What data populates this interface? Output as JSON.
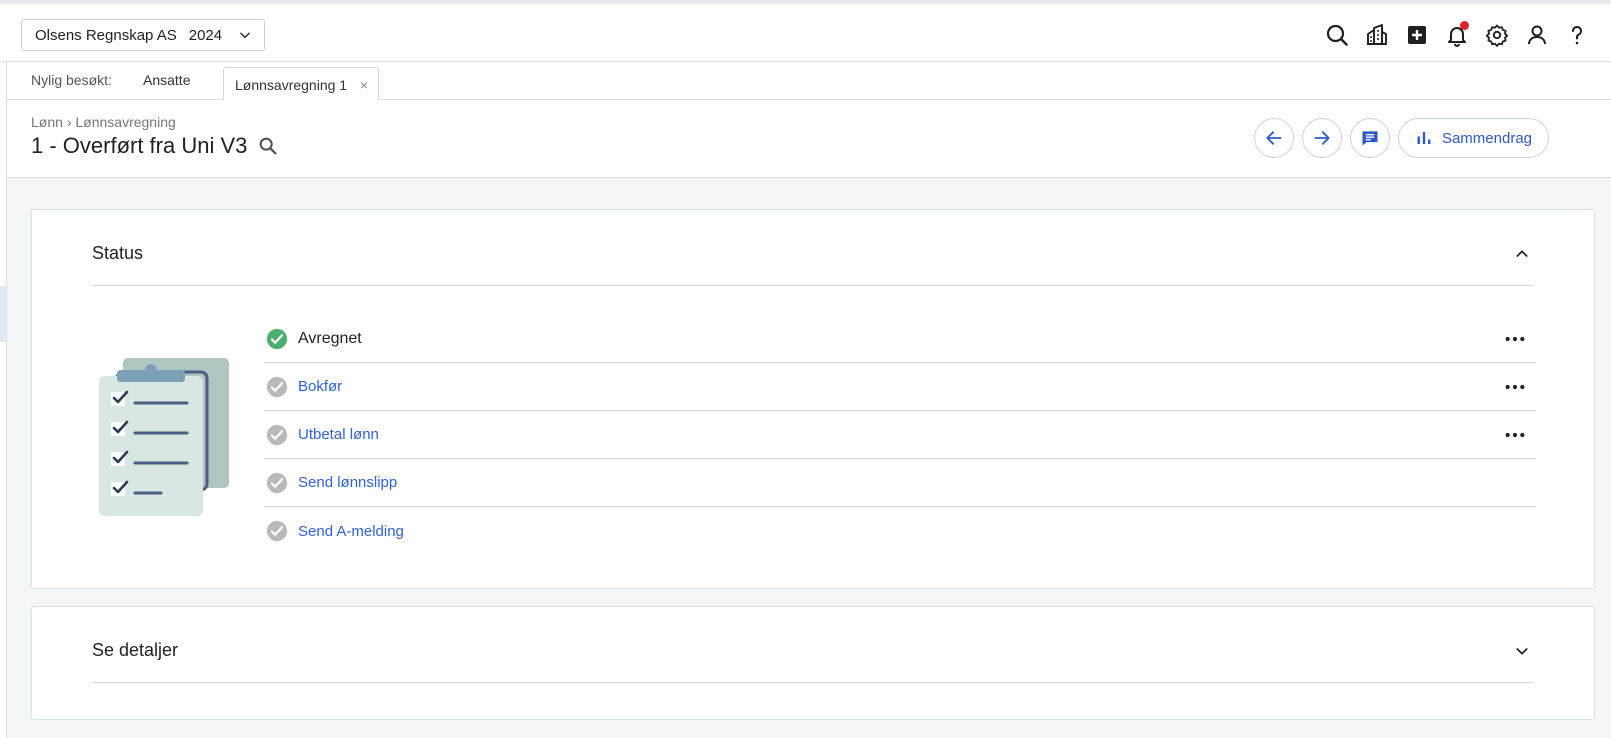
{
  "topbar": {
    "company": "Olsens Regnskap AS",
    "year": "2024",
    "icons": [
      "search-icon",
      "companies-icon",
      "new-icon",
      "notifications-icon",
      "settings-icon",
      "user-icon",
      "help-icon"
    ]
  },
  "tabs": {
    "recent_label": "Nylig besøkt:",
    "items": [
      "Ansatte",
      "Lønnsavregning 1"
    ],
    "close": "×"
  },
  "header": {
    "breadcrumb": [
      "Lønn",
      "Lønnsavregning"
    ],
    "breadcrumb_sep": "›",
    "title": "1 - Overført fra Uni V3",
    "summary_button": "Sammendrag"
  },
  "status": {
    "title": "Status",
    "steps": [
      {
        "label": "Avregnet",
        "done": true
      },
      {
        "label": "Bokfør",
        "done": false
      },
      {
        "label": "Utbetal lønn",
        "done": false
      },
      {
        "label": "Send lønnslipp",
        "done": false
      },
      {
        "label": "Send A-melding",
        "done": false
      }
    ]
  },
  "details": {
    "title": "Se detaljer"
  },
  "colors": {
    "accent": "#2f59c8",
    "link": "#2f62d6",
    "done": "#4cae6e",
    "pending": "#b7babd",
    "notification": "#e0202a"
  }
}
